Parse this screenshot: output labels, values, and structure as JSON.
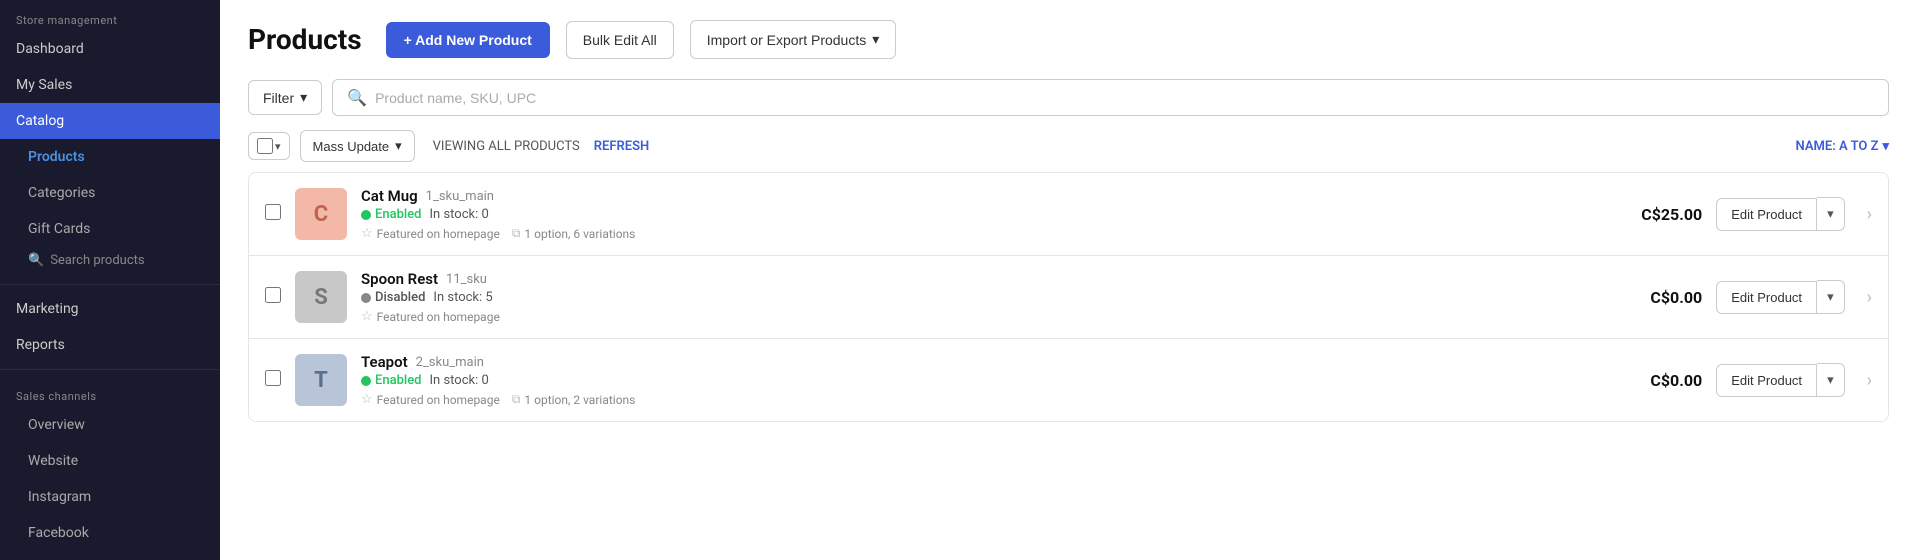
{
  "sidebar": {
    "store_management_label": "Store management",
    "items": [
      {
        "id": "dashboard",
        "label": "Dashboard",
        "active": false
      },
      {
        "id": "my-sales",
        "label": "My Sales",
        "active": false
      },
      {
        "id": "catalog",
        "label": "Catalog",
        "active": true
      }
    ],
    "catalog_sub": [
      {
        "id": "products",
        "label": "Products",
        "active": true
      },
      {
        "id": "categories",
        "label": "Categories",
        "active": false
      },
      {
        "id": "gift-cards",
        "label": "Gift Cards",
        "active": false
      }
    ],
    "search_placeholder": "Search products",
    "marketing_label": "Marketing",
    "reports_label": "Reports",
    "sales_channels_label": "Sales channels",
    "sales_channels": [
      {
        "id": "overview",
        "label": "Overview"
      },
      {
        "id": "website",
        "label": "Website"
      },
      {
        "id": "instagram",
        "label": "Instagram"
      },
      {
        "id": "facebook",
        "label": "Facebook"
      }
    ]
  },
  "page": {
    "title": "Products",
    "add_button": "+ Add New Product",
    "bulk_edit_button": "Bulk Edit All",
    "import_export_button": "Import or Export Products",
    "filter_button": "Filter",
    "search_placeholder": "Product name, SKU, UPC",
    "mass_update_label": "Mass Update",
    "viewing_label": "VIEWING ALL PRODUCTS",
    "refresh_label": "REFRESH",
    "sort_label": "NAME: A TO Z",
    "products": [
      {
        "id": "cat-mug",
        "avatar_letter": "C",
        "avatar_class": "cat",
        "name": "Cat Mug",
        "sku": "1_sku_main",
        "status": "Enabled",
        "status_type": "enabled",
        "stock": "In stock: 0",
        "featured": "Featured on homepage",
        "variations": "1 option, 6 variations",
        "price": "C$25.00",
        "edit_label": "Edit Product"
      },
      {
        "id": "spoon-rest",
        "avatar_letter": "S",
        "avatar_class": "spoon",
        "name": "Spoon Rest",
        "sku": "11_sku",
        "status": "Disabled",
        "status_type": "disabled",
        "stock": "In stock: 5",
        "featured": "Featured on homepage",
        "variations": null,
        "price": "C$0.00",
        "edit_label": "Edit Product"
      },
      {
        "id": "teapot",
        "avatar_letter": "T",
        "avatar_class": "teapot",
        "name": "Teapot",
        "sku": "2_sku_main",
        "status": "Enabled",
        "status_type": "enabled",
        "stock": "In stock: 0",
        "featured": "Featured on homepage",
        "variations": "1 option, 2 variations",
        "price": "C$0.00",
        "edit_label": "Edit Product"
      }
    ]
  }
}
